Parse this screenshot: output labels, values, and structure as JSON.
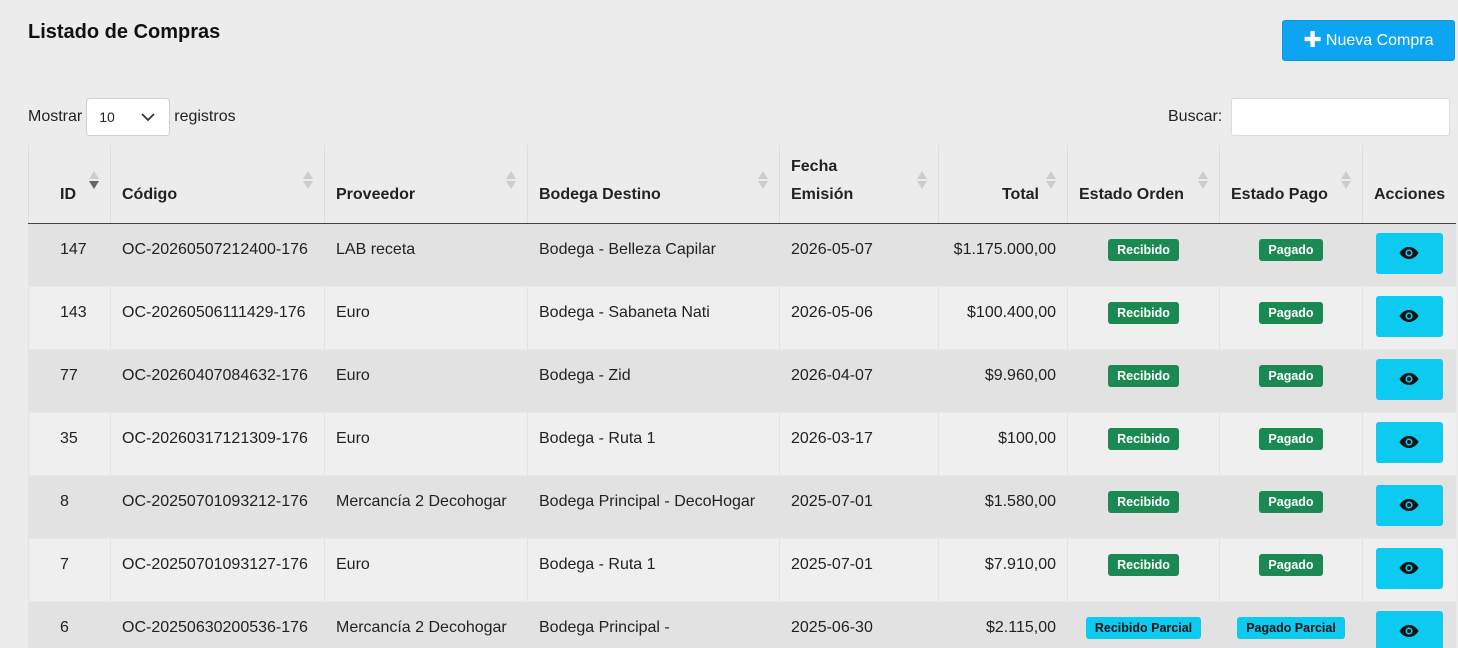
{
  "page": {
    "title": "Listado de Compras"
  },
  "toolbar": {
    "new_label": "Nueva Compra"
  },
  "length": {
    "prefix": "Mostrar",
    "value": "10",
    "suffix": "registros"
  },
  "search": {
    "label": "Buscar:",
    "value": "",
    "placeholder": ""
  },
  "table": {
    "headers": {
      "id": "ID",
      "codigo": "Código",
      "proveedor": "Proveedor",
      "bodega": "Bodega Destino",
      "fecha_1": "Fecha",
      "fecha_2": "Emisión",
      "total": "Total",
      "estado_orden": "Estado Orden",
      "estado_pago": "Estado Pago",
      "acciones": "Acciones"
    },
    "rows": [
      {
        "id": "147",
        "codigo": "OC-20260507212400-176",
        "proveedor": "LAB receta",
        "bodega": "Bodega - Belleza Capilar",
        "fecha": "2026-05-07",
        "total": "$1.175.000,00",
        "estado_orden": "Recibido",
        "estado_pago": "Pagado"
      },
      {
        "id": "143",
        "codigo": "OC-20260506111429-176",
        "proveedor": "Euro",
        "bodega": "Bodega - Sabaneta Nati",
        "fecha": "2026-05-06",
        "total": "$100.400,00",
        "estado_orden": "Recibido",
        "estado_pago": "Pagado"
      },
      {
        "id": "77",
        "codigo": "OC-20260407084632-176",
        "proveedor": "Euro",
        "bodega": "Bodega - Zid",
        "fecha": "2026-04-07",
        "total": "$9.960,00",
        "estado_orden": "Recibido",
        "estado_pago": "Pagado"
      },
      {
        "id": "35",
        "codigo": "OC-20260317121309-176",
        "proveedor": "Euro",
        "bodega": "Bodega - Ruta 1",
        "fecha": "2026-03-17",
        "total": "$100,00",
        "estado_orden": "Recibido",
        "estado_pago": "Pagado"
      },
      {
        "id": "8",
        "codigo": "OC-20250701093212-176",
        "proveedor": "Mercancía 2 Decohogar",
        "bodega": "Bodega Principal - DecoHogar",
        "fecha": "2025-07-01",
        "total": "$1.580,00",
        "estado_orden": "Recibido",
        "estado_pago": "Pagado"
      },
      {
        "id": "7",
        "codigo": "OC-20250701093127-176",
        "proveedor": "Euro",
        "bodega": "Bodega - Ruta 1",
        "fecha": "2025-07-01",
        "total": "$7.910,00",
        "estado_orden": "Recibido",
        "estado_pago": "Pagado"
      },
      {
        "id": "6",
        "codigo": "OC-20250630200536-176",
        "proveedor": "Mercancía 2 Decohogar",
        "bodega": "Bodega Principal -",
        "fecha": "2025-06-30",
        "total": "$2.115,00",
        "estado_orden": "Recibido Parcial",
        "estado_pago": "Pagado Parcial"
      }
    ]
  },
  "colors": {
    "primary": "#0da5f2",
    "success": "#1b8a52",
    "info": "#0dcaf0"
  },
  "icons": {
    "new": "plus-icon",
    "view": "eye-icon",
    "select": "chevron-down-icon",
    "sort": "sort-icon"
  }
}
